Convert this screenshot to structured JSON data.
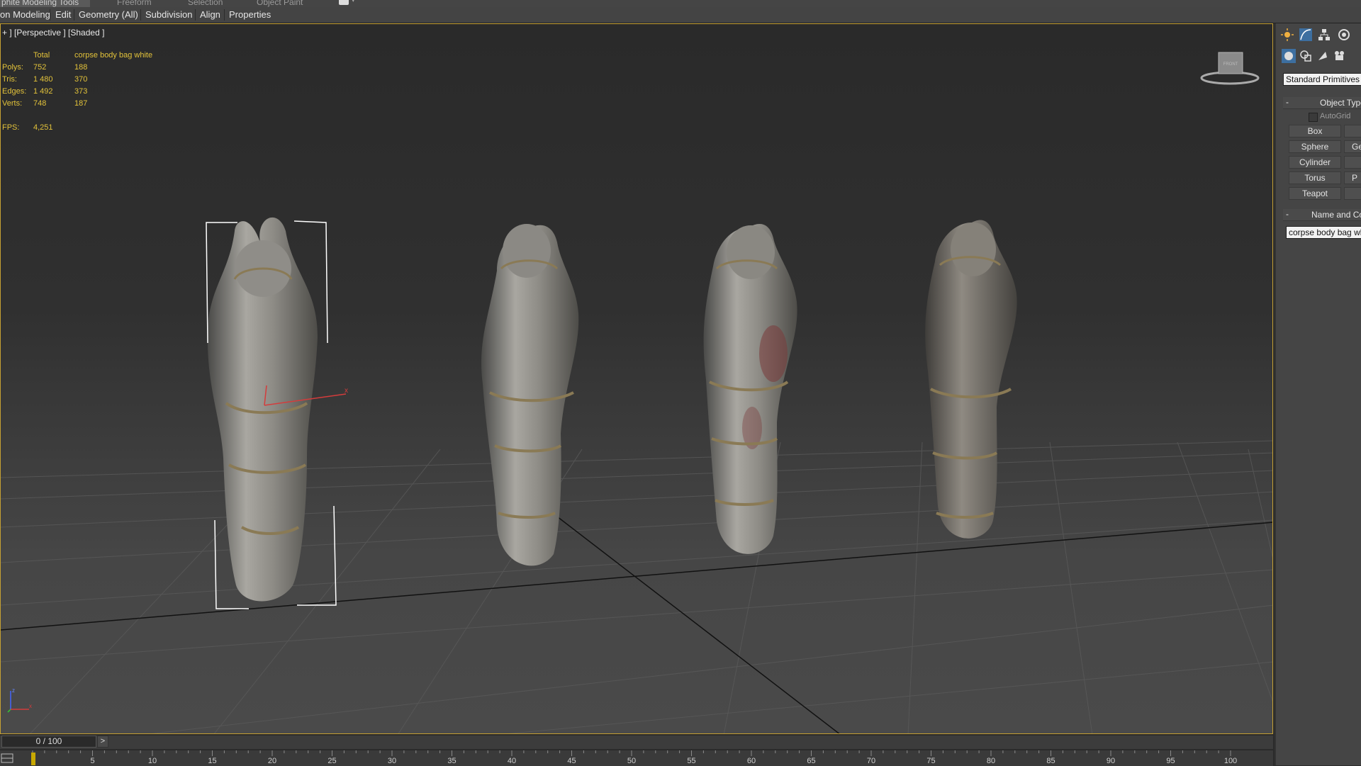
{
  "ribbon": {
    "tabs": [
      "phite Modeling Tools",
      "Freeform",
      "Selection",
      "Object Paint"
    ]
  },
  "menu": {
    "items": [
      "on Modeling",
      "Edit",
      "Geometry (All)",
      "Subdivision",
      "Align",
      "Properties"
    ]
  },
  "viewport": {
    "label": "+ ] [Perspective ] [Shaded ]",
    "stats": {
      "header_total": "Total",
      "header_object": "corpse body bag white",
      "rows": [
        {
          "label": "Polys:",
          "total": "752",
          "object": "188"
        },
        {
          "label": "Tris:",
          "total": "1 480",
          "object": "370"
        },
        {
          "label": "Edges:",
          "total": "1 492",
          "object": "373"
        },
        {
          "label": "Verts:",
          "total": "748",
          "object": "187"
        }
      ],
      "fps_label": "FPS:",
      "fps_value": "4,251"
    },
    "viewcube_label": "FRONT",
    "triad": {
      "x": "x",
      "z": "z"
    },
    "gizmo_axis": "x"
  },
  "command_panel": {
    "icons": [
      "sun-icon",
      "curve-icon",
      "hierarchy-icon",
      "motion-icon"
    ],
    "sub_icons": [
      "geometry-icon",
      "shapes-icon",
      "lights-icon",
      "cameras-icon"
    ],
    "dropdown": "Standard Primitives",
    "object_type_title": "Object Type",
    "autogrid_label": "AutoGrid",
    "buttons": [
      "Box",
      "Sphere",
      "Cylinder",
      "Torus",
      "Teapot"
    ],
    "buttons_right": [
      "",
      "Ge",
      "",
      "P",
      ""
    ],
    "name_color_title": "Name and Color",
    "name_value": "corpse body bag white"
  },
  "timeline": {
    "frame_display": "0 / 100",
    "next_label": ">",
    "ticks": [
      "5",
      "10",
      "15",
      "20",
      "25",
      "30",
      "35",
      "40",
      "45",
      "50",
      "55",
      "60",
      "65",
      "70",
      "75",
      "80",
      "85",
      "90",
      "95",
      "100"
    ]
  },
  "colors": {
    "selection_bracket": "#ffffff",
    "stats_text": "#e2c23a",
    "viewport_border": "#c6a133",
    "rope": "#8a7a55"
  }
}
